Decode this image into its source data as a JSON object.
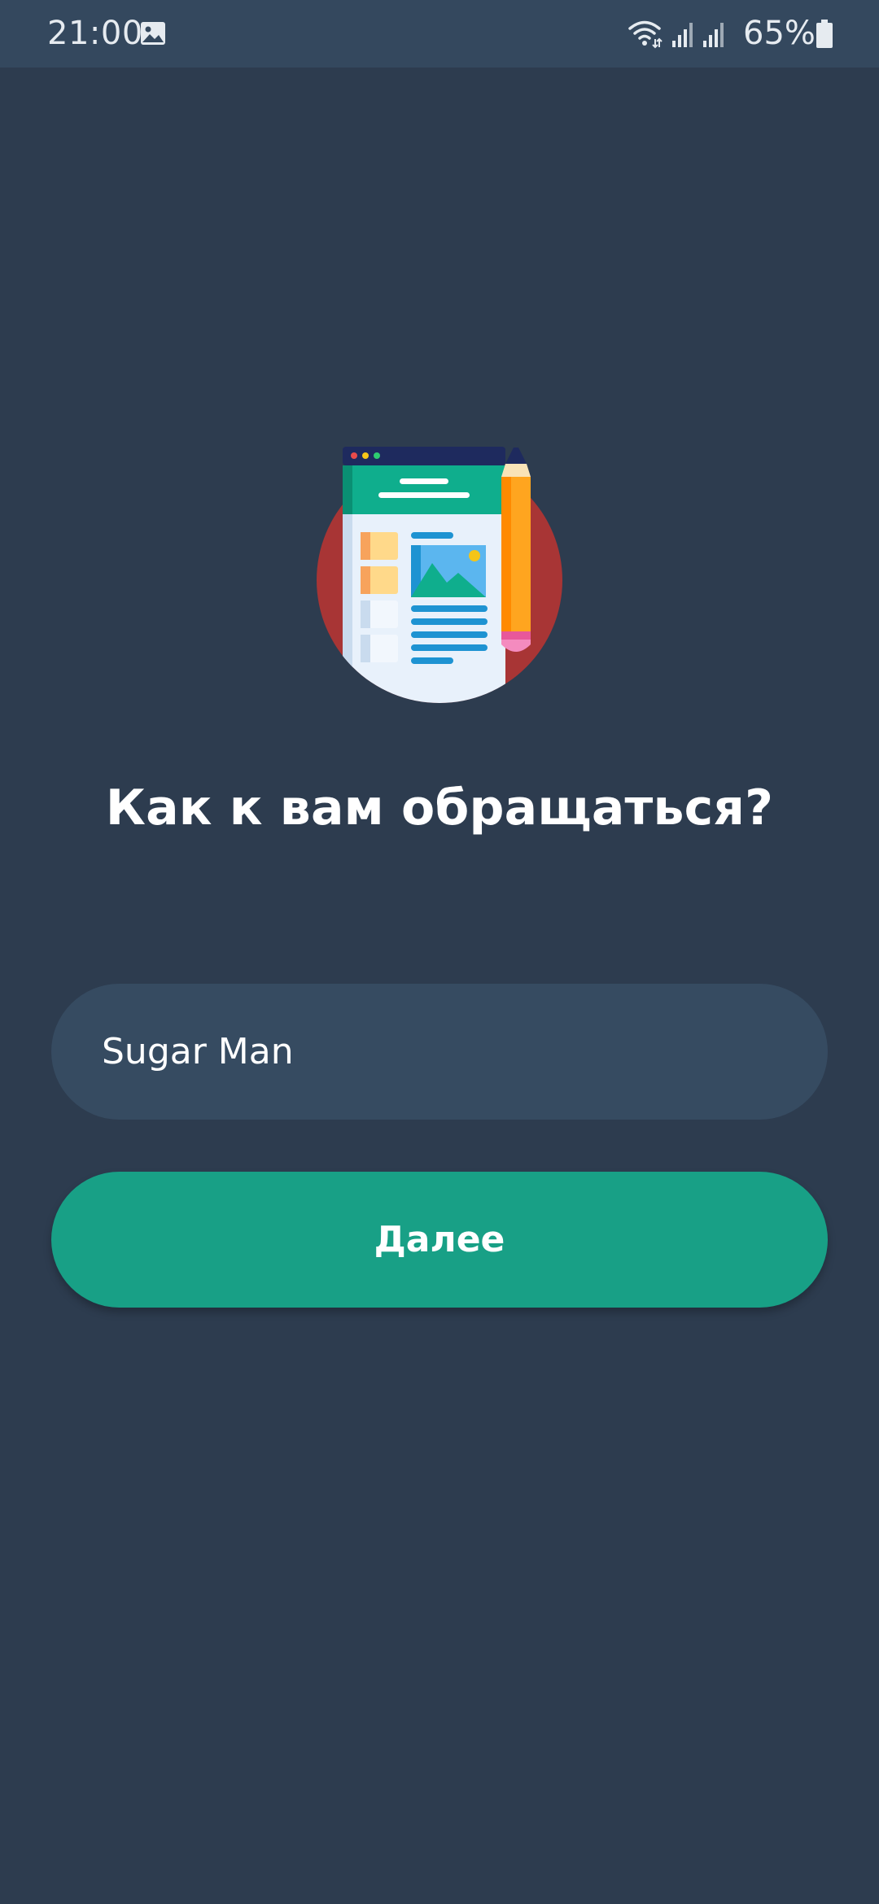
{
  "status_bar": {
    "time": "21:00",
    "battery_percent": "65%",
    "icons": [
      "gallery-icon",
      "wifi-icon",
      "signal-icon",
      "signal-icon",
      "battery-icon"
    ]
  },
  "illustration": {
    "icon": "document-with-pencil-illustration",
    "colors": {
      "circle": "#a83535",
      "header": "#0fae8d",
      "topbar": "#1e2a5e",
      "paper": "#e8f1fb",
      "lines": "#1e93d2",
      "sticky": "#ffd98a",
      "pencil": "#ff9c1a"
    }
  },
  "title": "Как к вам обращаться?",
  "name_field": {
    "value": "Sugar Man",
    "placeholder": ""
  },
  "next_button": {
    "label": "Далее"
  },
  "colors": {
    "background": "#2d3c4f",
    "status_bar": "#34485e",
    "input_bg": "#364b61",
    "accent": "#18a086"
  }
}
